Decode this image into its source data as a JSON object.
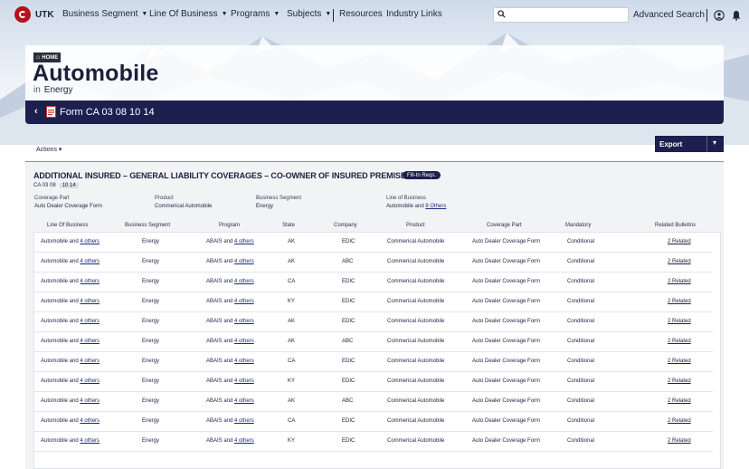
{
  "app": {
    "logo_text": "UTK"
  },
  "nav": {
    "items": [
      "Business Segment",
      "Line Of Business",
      "Programs",
      "Subjects",
      "Resources",
      "Industry Links"
    ],
    "search_placeholder": "",
    "advanced_search": "Advanced Search"
  },
  "breadcrumb": {
    "home": "HOME"
  },
  "page": {
    "title": "Automobile",
    "in_label": "in",
    "in_value": "Energy"
  },
  "form_bar": {
    "name": "Form CA 03 08 10 14"
  },
  "toolbar": {
    "actions_label": "Actions",
    "export_label": "Export"
  },
  "section": {
    "title": "ADDITIONAL INSURED – GENERAL LIABILITY COVERAGES – CO-OWNER OF INSURED PREMISES",
    "badge": "Fill-In Reqs.",
    "form_code": "CA 03 08",
    "edition": "10 14"
  },
  "meta": {
    "coverage_part_label": "Coverage Part",
    "coverage_part_value": "Auto Dealer Coverage Form",
    "product_label": "Product",
    "product_value": "Commerical Automobile",
    "business_segment_label": "Business Segment",
    "business_segment_value": "Energy",
    "lob_label": "Line of Business",
    "lob_value_prefix": "Automobile and ",
    "lob_value_link": "8 Others"
  },
  "table": {
    "headers": [
      "Line Of Business",
      "Business Segment",
      "Program",
      "State",
      "Company",
      "Product",
      "Coverage Part",
      "Mandatory",
      "Related Bulletins"
    ],
    "rows": [
      {
        "lob": "Automobile and ",
        "lob_link": "4 others",
        "seg": "Energy",
        "prog": "ABAIS and ",
        "prog_link": "4 others",
        "state": "AK",
        "company": "EDIC",
        "product": "Commerical Automobile",
        "coverage": "Auto Dealer Coverage Form",
        "mandatory": "Conditional",
        "related": "2 Related"
      },
      {
        "lob": "Automobile and ",
        "lob_link": "4 others",
        "seg": "Energy",
        "prog": "ABAIS and ",
        "prog_link": "4 others",
        "state": "AK",
        "company": "ABC",
        "product": "Commerical Automobile",
        "coverage": "Auto Dealer Coverage Form",
        "mandatory": "Conditional",
        "related": "2 Related"
      },
      {
        "lob": "Automobile and ",
        "lob_link": "4 others",
        "seg": "Energy",
        "prog": "ABAIS and ",
        "prog_link": "4 others",
        "state": "CA",
        "company": "EDIC",
        "product": "Commerical Automobile",
        "coverage": "Auto Dealer Coverage Form",
        "mandatory": "Conditional",
        "related": "2 Related"
      },
      {
        "lob": "Automobile and ",
        "lob_link": "4 others",
        "seg": "Energy",
        "prog": "ABAIS and ",
        "prog_link": "4 others",
        "state": "KY",
        "company": "EDIC",
        "product": "Commerical Automobile",
        "coverage": "Auto Dealer Coverage Form",
        "mandatory": "Conditional",
        "related": "2 Related"
      },
      {
        "lob": "Automobile and ",
        "lob_link": "4 others",
        "seg": "Energy",
        "prog": "ABAIS and ",
        "prog_link": "4 others",
        "state": "AK",
        "company": "EDIC",
        "product": "Commerical Automobile",
        "coverage": "Auto Dealer Coverage Form",
        "mandatory": "Conditional",
        "related": "2 Related"
      },
      {
        "lob": "Automobile and ",
        "lob_link": "4 others",
        "seg": "Energy",
        "prog": "ABAIS and ",
        "prog_link": "4 others",
        "state": "AK",
        "company": "ABC",
        "product": "Commerical Automobile",
        "coverage": "Auto Dealer Coverage Form",
        "mandatory": "Conditional",
        "related": "2 Related"
      },
      {
        "lob": "Automobile and ",
        "lob_link": "4 others",
        "seg": "Energy",
        "prog": "ABAIS and ",
        "prog_link": "4 others",
        "state": "CA",
        "company": "EDIC",
        "product": "Commerical Automobile",
        "coverage": "Auto Dealer Coverage Form",
        "mandatory": "Conditional",
        "related": "2 Related"
      },
      {
        "lob": "Automobile and ",
        "lob_link": "4 others",
        "seg": "Energy",
        "prog": "ABAIS and ",
        "prog_link": "4 others",
        "state": "KY",
        "company": "EDIC",
        "product": "Commerical Automobile",
        "coverage": "Auto Dealer Coverage Form",
        "mandatory": "Conditional",
        "related": "2 Related"
      },
      {
        "lob": "Automobile and ",
        "lob_link": "4 others",
        "seg": "Energy",
        "prog": "ABAIS and ",
        "prog_link": "4 others",
        "state": "AK",
        "company": "ABC",
        "product": "Commerical Automobile",
        "coverage": "Auto Dealer Coverage Form",
        "mandatory": "Conditional",
        "related": "2 Related"
      },
      {
        "lob": "Automobile and ",
        "lob_link": "4 others",
        "seg": "Energy",
        "prog": "ABAIS and ",
        "prog_link": "4 others",
        "state": "CA",
        "company": "EDIC",
        "product": "Commerical Automobile",
        "coverage": "Auto Dealer Coverage Form",
        "mandatory": "Conditional",
        "related": "2 Related"
      },
      {
        "lob": "Automobile and ",
        "lob_link": "4 others",
        "seg": "Energy",
        "prog": "ABAIS and ",
        "prog_link": "4 others",
        "state": "KY",
        "company": "EDIC",
        "product": "Commerical Automobile",
        "coverage": "Auto Dealer Coverage Form",
        "mandatory": "Conditional",
        "related": "2 Related"
      }
    ]
  },
  "colors": {
    "navy": "#1d1f4f",
    "brand_red": "#b5121b",
    "link": "#1d2a7a"
  },
  "icons": [
    "logo-icon",
    "search-icon",
    "user-icon",
    "bell-icon",
    "home-icon",
    "chevron-left-icon",
    "pdf-icon",
    "chevron-down-icon"
  ]
}
